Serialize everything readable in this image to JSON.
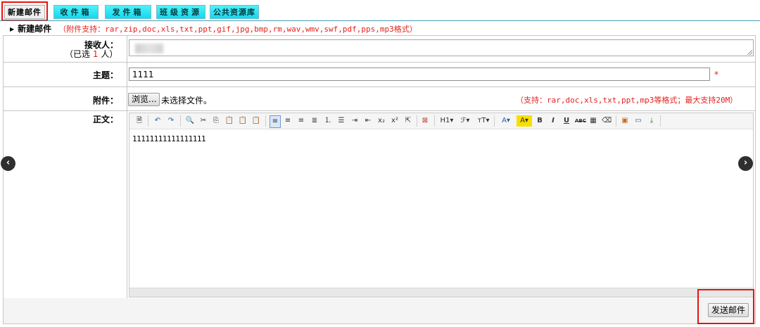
{
  "tabs": [
    {
      "label": "新建邮件",
      "active": true
    },
    {
      "label": "收件箱",
      "active": false
    },
    {
      "label": "发件箱",
      "active": false
    },
    {
      "label": "班级资源",
      "active": false
    },
    {
      "label": "公共资源库",
      "active": false
    }
  ],
  "section": {
    "title": "新建邮件",
    "note": "（附件支持：rar,zip,doc,xls,txt,ppt,gif,jpg,bmp,rm,wav,wmv,swf,pdf,pps,mp3格式）"
  },
  "recipient": {
    "label": "接收人：",
    "selected_prefix": "（已选",
    "selected_count": "1",
    "selected_suffix": "人）"
  },
  "subject": {
    "label": "主题：",
    "value": "1111",
    "required_mark": "*"
  },
  "attachment": {
    "label": "附件：",
    "browse_label": "浏览...",
    "no_file_text": "未选择文件。",
    "note": "（支持：rar,doc,xls,txt,ppt,mp3等格式；最大支持20M）"
  },
  "body": {
    "label": "正文：",
    "content": "11111111111111111"
  },
  "toolbar": {
    "heading_label": "H1",
    "font_label": "ℱ",
    "size_label": "тT"
  },
  "send_button": "发送邮件",
  "colors": {
    "tab_inactive": "#1ee0f2",
    "highlight": "#e8140f",
    "note_red": "#e5201b"
  }
}
